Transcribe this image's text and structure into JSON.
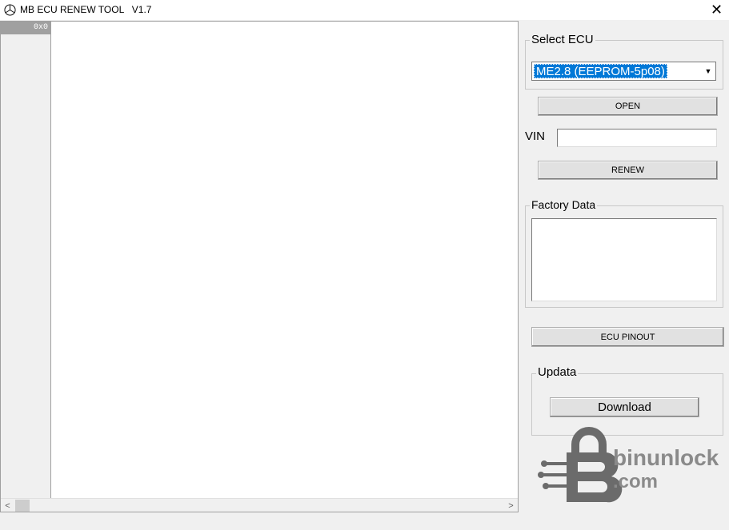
{
  "window": {
    "title": "MB ECU RENEW TOOL   V1.7",
    "close_glyph": "✕"
  },
  "hex_view": {
    "address_header": "0x0",
    "scroll_left": "<",
    "scroll_right": ">"
  },
  "select_ecu": {
    "group_label": "Select ECU",
    "selected_value": "ME2.8 (EEPROM-5p08)",
    "open_button": "OPEN"
  },
  "vin": {
    "label": "VIN",
    "value": ""
  },
  "renew_button": "RENEW",
  "factory_data": {
    "group_label": "Factory Data",
    "value": ""
  },
  "ecu_pinout_button": "ECU PINOUT",
  "updata": {
    "group_label": "Updata",
    "download_button": "Download"
  },
  "watermark": {
    "brand": "binunlock",
    "domain": ".com"
  },
  "colors": {
    "selection": "#0078d7",
    "address_header_bg": "#a0a0a0",
    "window_bg": "#f0f0f0"
  }
}
